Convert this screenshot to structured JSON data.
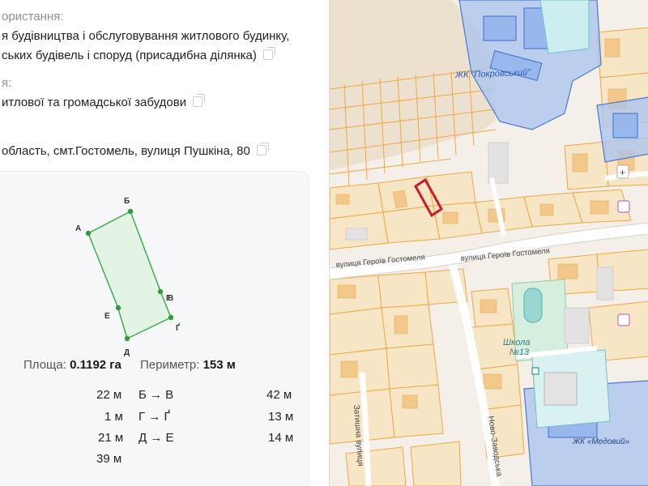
{
  "parcel": {
    "purpose_label": "Цільове призначення використання:",
    "purpose_label_visible": "ористання:",
    "purpose_line1": "я будівництва і обслуговування житлового будинку,",
    "purpose_line2": "ських будівель і споруд (присадибна ділянка)",
    "zone_label_visible": "я:",
    "zone_value": "итлової та громадської забудови",
    "address": "область, смт.Гостомель, вулиця Пушкіна, 80"
  },
  "shape": {
    "vertices": [
      "А",
      "Б",
      "В",
      "Ґ",
      "Д",
      "Е"
    ],
    "vertex_b_hint": "Г"
  },
  "stats": {
    "area_label": "Площа:",
    "area_value": "0.1192 га",
    "perimeter_label": "Периметр:",
    "perimeter_value": "153 м"
  },
  "segments_left": [
    "22 м",
    "1 м",
    "21 м",
    "39 м"
  ],
  "segments_mid": [
    "Б → В",
    "Г → Ґ",
    "Д → Е"
  ],
  "segments_right": [
    "42 м",
    "13 м",
    "14 м"
  ],
  "map": {
    "labels": {
      "pokrovskyi": "ЖК \"Покровський\"",
      "street1": "вулиця Героїв Гостомеля",
      "street2": "вулиця Героїв Гостомеля",
      "school": "Школа",
      "school_no": "№13",
      "medovyi": "ЖК «Медовий»",
      "novo": "Ново-Заводська",
      "zatyshna": "Затишна вулиця"
    },
    "colors": {
      "parcel_outline": "#f0a640",
      "parcel_fill": "#f4dfb3",
      "building_fill": "#f2c98a",
      "blue_zone": "#a9c3f0",
      "blue_zone_border": "#4a78d4",
      "green": "#bfe3c6",
      "highlight": "#c91c28",
      "road": "#ffffff"
    }
  }
}
